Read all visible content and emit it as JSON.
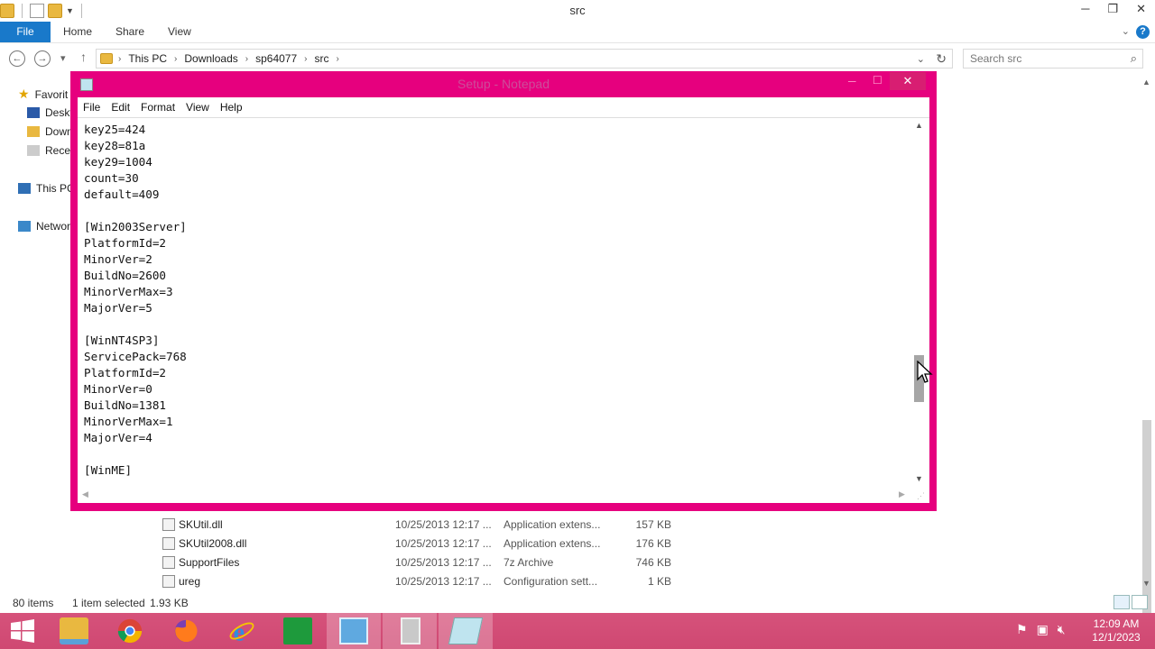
{
  "explorer": {
    "title": "src",
    "ribbon": {
      "file": "File",
      "home": "Home",
      "share": "Share",
      "view": "View"
    },
    "breadcrumb": [
      "This PC",
      "Downloads",
      "sp64077",
      "src"
    ],
    "search_placeholder": "Search src",
    "nav": [
      {
        "label": "Favorit",
        "icon": "star-icon"
      },
      {
        "label": "Deskt",
        "icon": "desktop-icon"
      },
      {
        "label": "Down",
        "icon": "downloads-icon"
      },
      {
        "label": "Recen",
        "icon": "recent-icon"
      },
      {
        "label": "This PC",
        "icon": "computer-icon"
      },
      {
        "label": "Networ",
        "icon": "network-icon"
      }
    ],
    "files": [
      {
        "name": "SKUtil.dll",
        "date": "10/25/2013 12:17 ...",
        "type": "Application extens...",
        "size": "157 KB"
      },
      {
        "name": "SKUtil2008.dll",
        "date": "10/25/2013 12:17 ...",
        "type": "Application extens...",
        "size": "176 KB"
      },
      {
        "name": "SupportFiles",
        "date": "10/25/2013 12:17 ...",
        "type": "7z Archive",
        "size": "746 KB"
      },
      {
        "name": "ureg",
        "date": "10/25/2013 12:17 ...",
        "type": "Configuration sett...",
        "size": "1 KB"
      }
    ],
    "status": {
      "items": "80 items",
      "selected": "1 item selected",
      "size": "1.93 KB"
    }
  },
  "notepad": {
    "title": "Setup - Notepad",
    "menu": [
      "File",
      "Edit",
      "Format",
      "View",
      "Help"
    ],
    "text": "key25=424\nkey28=81a\nkey29=1004\ncount=30\ndefault=409\n\n[Win2003Server]\nPlatformId=2\nMinorVer=2\nBuildNo=2600\nMinorVerMax=3\nMajorVer=5\n\n[WinNT4SP3]\nServicePack=768\nPlatformId=2\nMinorVer=0\nBuildNo=1381\nMinorVerMax=1\nMajorVer=4\n\n[WinME]"
  },
  "taskbar": {
    "apps": [
      {
        "name": "file-explorer",
        "icon": "folder-icon"
      },
      {
        "name": "chrome",
        "icon": "chrome-icon"
      },
      {
        "name": "firefox",
        "icon": "firefox-icon"
      },
      {
        "name": "internet-explorer",
        "icon": "ie-icon"
      },
      {
        "name": "store",
        "icon": "store-icon"
      },
      {
        "name": "control-panel",
        "icon": "control-panel-icon"
      },
      {
        "name": "installer",
        "icon": "installer-icon"
      },
      {
        "name": "notepad",
        "icon": "notepad-icon"
      }
    ],
    "time": "12:09 AM",
    "date": "12/1/2023"
  },
  "colors": {
    "accent": "#1979ca",
    "notepad_frame": "#e6007e",
    "taskbar": "#d6527b"
  }
}
